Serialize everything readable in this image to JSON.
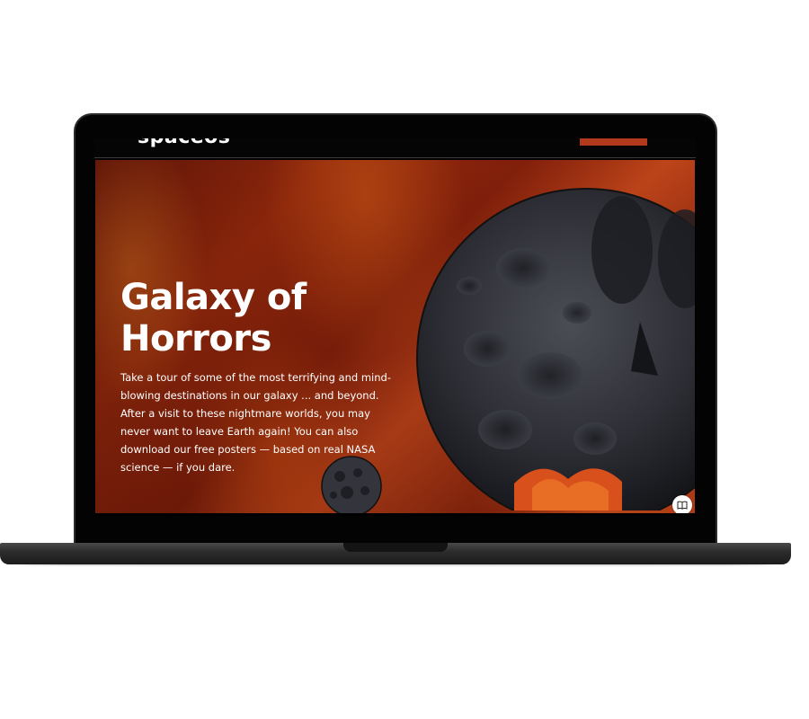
{
  "site": {
    "logo_text": "spaceos",
    "accent_color": "#b23a1c"
  },
  "hero": {
    "title": "Galaxy of Horrors",
    "description": "Take a tour of some of the most terrifying and mind-blowing destinations in our galaxy ... and beyond. After a visit to these nightmare worlds, you may never want to leave Earth again! You can also download our free posters — based on real NASA science — if you dare.",
    "background_color": "#a9300f"
  },
  "controls": {
    "reader_icon": "book-icon"
  }
}
